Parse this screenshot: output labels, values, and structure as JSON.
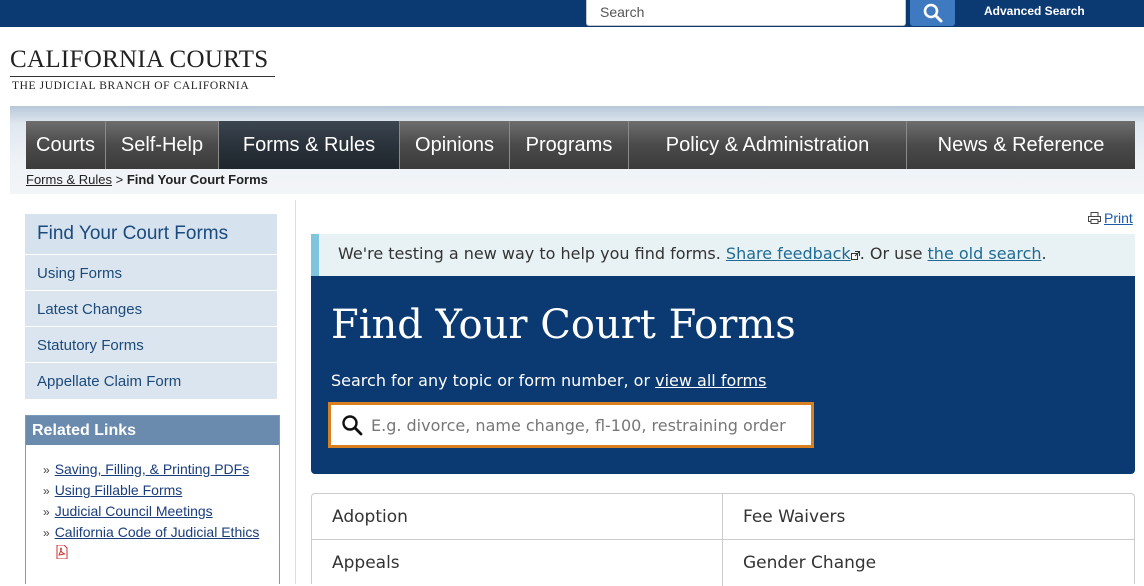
{
  "topbar": {
    "search_placeholder": "Search",
    "advanced_search": "Advanced Search"
  },
  "logo": {
    "title": "CALIFORNIA COURTS",
    "subtitle": "THE JUDICIAL BRANCH OF CALIFORNIA"
  },
  "nav": {
    "items": [
      {
        "label": "Courts"
      },
      {
        "label": "Self-Help"
      },
      {
        "label": "Forms & Rules"
      },
      {
        "label": "Opinions"
      },
      {
        "label": "Programs"
      },
      {
        "label": "Policy & Administration"
      },
      {
        "label": "News & Reference"
      }
    ],
    "active": "Forms & Rules"
  },
  "breadcrumb": {
    "parent": "Forms & Rules",
    "separator": ">",
    "current": "Find Your Court Forms"
  },
  "sidebar": {
    "heading": "Find Your Court Forms",
    "items": [
      {
        "label": "Using Forms"
      },
      {
        "label": "Latest Changes"
      },
      {
        "label": "Statutory Forms"
      },
      {
        "label": "Appellate Claim Form"
      }
    ]
  },
  "related": {
    "heading": "Related Links",
    "bullet": "»",
    "links": [
      {
        "label": "Saving, Filling, & Printing PDFs"
      },
      {
        "label": "Using Fillable Forms"
      },
      {
        "label": "Judicial Council Meetings"
      },
      {
        "label": "California Code of Judicial Ethics"
      }
    ]
  },
  "print": {
    "label": "Print"
  },
  "notice": {
    "text": "We're testing a new way to help you find forms.",
    "feedback_link": "Share feedback",
    "middle": ". Or use",
    "old_search_link": "the old search",
    "end": "."
  },
  "hero": {
    "title": "Find Your Court Forms",
    "subtitle": "Search for any topic or form number, or",
    "view_all_link": "view all forms",
    "search_placeholder": "E.g. divorce, name change, fl-100, restraining order"
  },
  "topics": [
    {
      "label": "Adoption"
    },
    {
      "label": "Fee Waivers"
    },
    {
      "label": "Appeals"
    },
    {
      "label": "Gender Change"
    }
  ],
  "colors": {
    "brand_navy": "#0b3a73",
    "search_button": "#3f7ac0",
    "input_focus_border": "#d87f1f",
    "notice_bar": "#7fc5de",
    "sidebar_bg": "#dbe5ef",
    "related_header": "#6a8aae"
  }
}
